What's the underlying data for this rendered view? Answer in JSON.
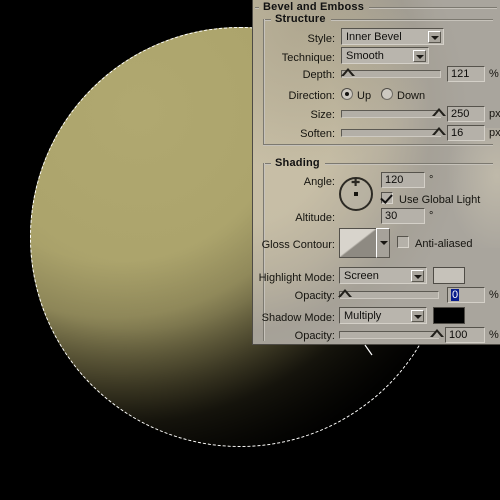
{
  "document": {
    "background_color": "#000000",
    "artwork": {
      "shape": "circle",
      "name": "beveled-gold-circle",
      "fill_color": "#b0a870",
      "shadow_color": "#000000",
      "selection": "marching-ants-ellipse"
    }
  },
  "panel": {
    "title": "Bevel and Emboss",
    "structure": {
      "group_label": "Structure",
      "style": {
        "label": "Style:",
        "value": "Inner Bevel"
      },
      "technique": {
        "label": "Technique:",
        "value": "Smooth"
      },
      "depth": {
        "label": "Depth:",
        "value": "121",
        "unit": "%",
        "slider_pct": 7
      },
      "direction": {
        "label": "Direction:",
        "up_label": "Up",
        "down_label": "Down",
        "selected": "Up"
      },
      "size": {
        "label": "Size:",
        "value": "250",
        "unit": "px",
        "slider_pct": 100
      },
      "soften": {
        "label": "Soften:",
        "value": "16",
        "unit": "px",
        "slider_pct": 100
      }
    },
    "shading": {
      "group_label": "Shading",
      "angle": {
        "label": "Angle:",
        "value": "120",
        "unit": "°"
      },
      "use_global_light": {
        "label": "Use Global Light",
        "checked": true
      },
      "altitude": {
        "label": "Altitude:",
        "value": "30",
        "unit": "°"
      },
      "gloss_contour": {
        "label": "Gloss Contour:"
      },
      "anti_aliased": {
        "label": "Anti-aliased",
        "checked": false
      },
      "highlight_mode": {
        "label": "Highlight Mode:",
        "value": "Screen",
        "swatch_color": "#c6c2ba"
      },
      "highlight_opacity": {
        "label": "Opacity:",
        "value": "0",
        "unit": "%",
        "slider_pct": 0,
        "selected": true
      },
      "shadow_mode": {
        "label": "Shadow Mode:",
        "value": "Multiply",
        "swatch_color": "#000000"
      },
      "shadow_opacity": {
        "label": "Opacity:",
        "value": "100",
        "unit": "%",
        "slider_pct": 100
      }
    }
  }
}
